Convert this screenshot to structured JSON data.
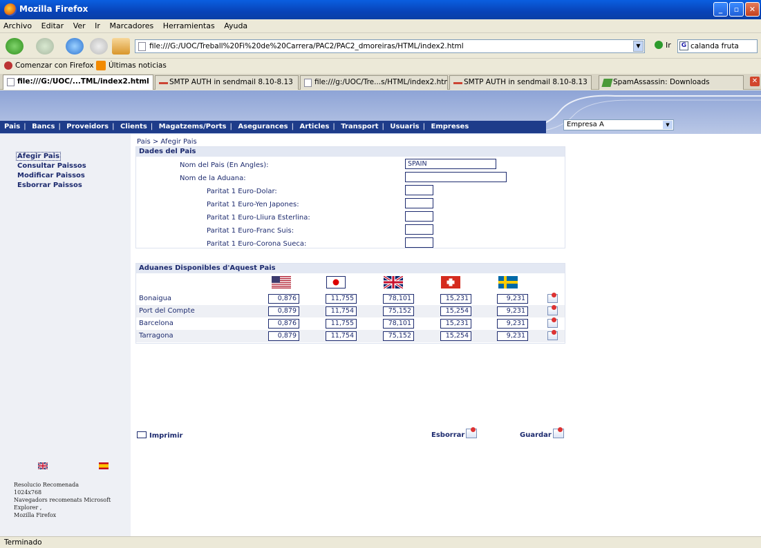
{
  "window": {
    "title": "Mozilla Firefox"
  },
  "menu": [
    "Archivo",
    "Editar",
    "Ver",
    "Ir",
    "Marcadores",
    "Herramientas",
    "Ayuda"
  ],
  "nav": {
    "url": "file:///G:/UOC/Treball%20Fi%20de%20Carrera/PAC2/PAC2_dmoreiras/HTML/index2.html",
    "go_label": "Ir",
    "search_value": "calanda fruta"
  },
  "bookmarks": [
    "Comenzar con Firefox",
    "Últimas noticias"
  ],
  "tabs": [
    {
      "label": "file:///G:/UOC/...TML/index2.html",
      "icon": "page-icon",
      "active": true
    },
    {
      "label": "SMTP AUTH in sendmail 8.10-8.13",
      "icon": "sendmail-icon",
      "active": false
    },
    {
      "label": "file:///g:/UOC/Tre...s/HTML/index2.html",
      "icon": "page-icon",
      "active": false
    },
    {
      "label": "SMTP AUTH in sendmail 8.10-8.13",
      "icon": "sendmail-icon",
      "active": false
    },
    {
      "label": "SpamAssassin: Downloads",
      "icon": "spam-icon",
      "active": false
    }
  ],
  "topnav": [
    "Pais",
    "Bancs",
    "Proveidors",
    "Clients",
    "Magatzems/Ports",
    "Asegurances",
    "Articles",
    "Transport",
    "Usuaris",
    "Empreses"
  ],
  "empresa_select": "Empresa A",
  "sidebar": {
    "items": [
      "Afegir Pais",
      "Consultar Paissos",
      "Modificar Paissos",
      "Esborrar Paissos"
    ],
    "note": [
      "Resolucio Recomenada",
      "1024x768",
      "Navegadors recomenats Microsoft Explorer ,",
      "Mozilla Firefox"
    ]
  },
  "breadcrumb": "Pais > Afegir Pais",
  "form": {
    "header": "Dades del Pais",
    "fields": [
      {
        "label": "Nom del Pais (En Angles):",
        "value": "SPAIN"
      },
      {
        "label": "Nom de la Aduana:",
        "value": ""
      },
      {
        "label": "Paritat 1 Euro-Dolar:",
        "value": ""
      },
      {
        "label": "Paritat 1 Euro-Yen Japones:",
        "value": ""
      },
      {
        "label": "Paritat 1 Euro-Lliura Esterlina:",
        "value": ""
      },
      {
        "label": "Paritat 1 Euro-Franc Suis:",
        "value": ""
      },
      {
        "label": "Paritat 1 Euro-Corona Sueca:",
        "value": ""
      }
    ]
  },
  "aduanes": {
    "header": "Aduanes Disponibles d'Aquest Pais",
    "flags": [
      "usa-flag",
      "japan-flag",
      "uk-flag",
      "switzerland-flag",
      "sweden-flag"
    ],
    "rows": [
      {
        "name": "Bonaigua",
        "values": [
          "0,876",
          "11,755",
          "78,101",
          "15,231",
          "9,231"
        ]
      },
      {
        "name": "Port del Compte",
        "values": [
          "0,879",
          "11,754",
          "75,152",
          "15,254",
          "9,231"
        ]
      },
      {
        "name": "Barcelona",
        "values": [
          "0,876",
          "11,755",
          "78,101",
          "15,231",
          "9,231"
        ]
      },
      {
        "name": "Tarragona",
        "values": [
          "0,879",
          "11,754",
          "75,152",
          "15,254",
          "9,231"
        ]
      }
    ]
  },
  "actions": {
    "print": "Imprimir",
    "delete": "Esborrar",
    "save": "Guardar"
  },
  "status": "Terminado"
}
